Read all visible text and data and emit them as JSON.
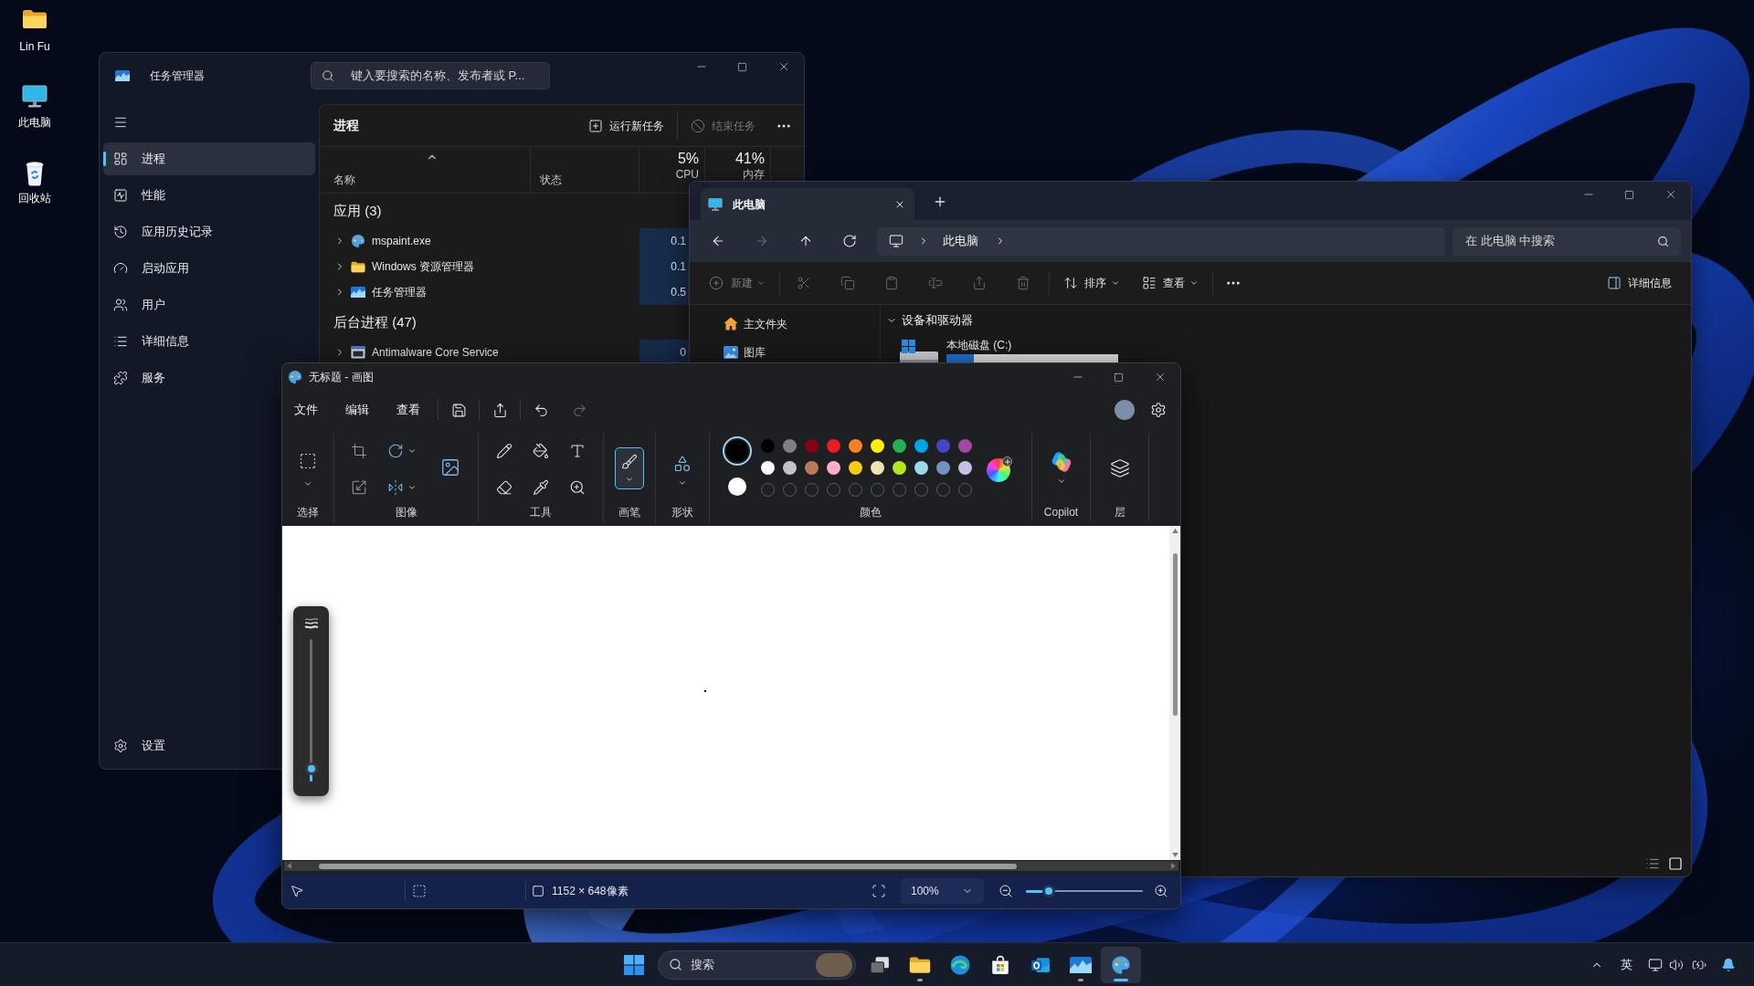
{
  "desktop_icons": [
    {
      "kind": "folder",
      "label": "Lin Fu"
    },
    {
      "kind": "computer",
      "label": "此电脑"
    },
    {
      "kind": "recycle-bin",
      "label": "回收站"
    }
  ],
  "task_manager": {
    "title": "任务管理器",
    "search": {
      "placeholder": "键入要搜索的名称、发布者或 P..."
    },
    "nav": [
      {
        "kind": "processes",
        "label": "进程",
        "selected": true
      },
      {
        "kind": "performance",
        "label": "性能",
        "selected": false
      },
      {
        "kind": "app-history",
        "label": "应用历史记录",
        "selected": false
      },
      {
        "kind": "startup",
        "label": "启动应用",
        "selected": false
      },
      {
        "kind": "users",
        "label": "用户",
        "selected": false
      },
      {
        "kind": "details",
        "label": "详细信息",
        "selected": false
      },
      {
        "kind": "services",
        "label": "服务",
        "selected": false
      }
    ],
    "settings": "设置",
    "page_title": "进程",
    "actions": [
      {
        "kind": "run",
        "label": "运行新任务",
        "disabled": false
      },
      {
        "kind": "end",
        "label": "结束任务",
        "disabled": true
      }
    ],
    "columns": [
      {
        "kind": "name",
        "label": "名称"
      },
      {
        "kind": "status",
        "label": "状态"
      },
      {
        "kind": "metric",
        "percent": "5%",
        "label": "CPU"
      },
      {
        "kind": "metric",
        "percent": "41%",
        "label": "内存"
      }
    ],
    "groups": [
      {
        "title": "应用 (3)",
        "rows": [
          {
            "kind": "paint",
            "name": "mspaint.exe",
            "cpu": "0.1"
          },
          {
            "kind": "explorer",
            "name": "Windows 资源管理器",
            "cpu": "0.1"
          },
          {
            "kind": "task-manager",
            "name": "任务管理器",
            "cpu": "0.5"
          }
        ]
      },
      {
        "title": "后台进程 (47)",
        "rows": [
          {
            "kind": "service",
            "name": "Antimalware Core Service",
            "cpu": "0"
          }
        ]
      }
    ]
  },
  "explorer": {
    "tabs": [
      {
        "label": "此电脑",
        "selected": true
      }
    ],
    "nav_buttons": [
      {
        "kind": "back",
        "disabled": false
      },
      {
        "kind": "forward",
        "disabled": true
      },
      {
        "kind": "up",
        "disabled": false
      },
      {
        "kind": "refresh",
        "disabled": false
      }
    ],
    "breadcrumb": [
      "此电脑"
    ],
    "search": {
      "placeholder": "在 此电脑 中搜索"
    },
    "new": {
      "label": "新建",
      "disabled": true
    },
    "edit_tools": [
      {
        "kind": "cut",
        "disabled": true
      },
      {
        "kind": "copy",
        "disabled": true
      },
      {
        "kind": "paste",
        "disabled": true
      },
      {
        "kind": "rename",
        "disabled": true
      },
      {
        "kind": "share",
        "disabled": true
      },
      {
        "kind": "delete",
        "disabled": true
      }
    ],
    "sort": "排序",
    "view": "查看",
    "details": "详细信息",
    "nav_pane": [
      {
        "kind": "home",
        "label": "主文件夹"
      },
      {
        "kind": "gallery",
        "label": "图库"
      }
    ],
    "section": {
      "title": "设备和驱动器",
      "expanded": true
    },
    "drives": [
      {
        "name": "本地磁盘 (C:)",
        "level": 0.16
      }
    ],
    "view_modes": [
      {
        "kind": "details",
        "selected": false
      },
      {
        "kind": "tiles",
        "selected": true
      }
    ]
  },
  "paint": {
    "title": "无标题 - 画图",
    "menus": [
      "文件",
      "编辑",
      "查看"
    ],
    "quick_actions": [
      {
        "kind": "save",
        "disabled": false
      },
      {
        "kind": "share",
        "disabled": false
      },
      {
        "kind": "undo",
        "disabled": false
      },
      {
        "kind": "redo",
        "disabled": true
      }
    ],
    "groups": [
      {
        "kind": "selection",
        "label": "选择"
      },
      {
        "kind": "image",
        "label": "图像"
      },
      {
        "kind": "tools",
        "label": "工具"
      },
      {
        "kind": "brushes",
        "label": "画笔"
      },
      {
        "kind": "shapes",
        "label": "形状"
      },
      {
        "kind": "colors",
        "label": "颜色"
      },
      {
        "kind": "copilot",
        "label": "Copilot"
      },
      {
        "kind": "layers",
        "label": "层"
      }
    ],
    "tools": [
      {
        "kind": "pencil",
        "selected": false
      },
      {
        "kind": "fill",
        "selected": false
      },
      {
        "kind": "text",
        "selected": false
      },
      {
        "kind": "eraser",
        "selected": false
      },
      {
        "kind": "picker",
        "selected": false
      },
      {
        "kind": "magnifier",
        "selected": false
      }
    ],
    "brush": {
      "selected": true
    },
    "current_colors": [
      {
        "kind": "primary",
        "color": "#000000",
        "selected": true
      },
      {
        "kind": "secondary",
        "color": "#ffffff",
        "selected": false
      }
    ],
    "palette": [
      {
        "color": "#000000"
      },
      {
        "color": "#7f7f7f"
      },
      {
        "color": "#880015"
      },
      {
        "color": "#ed1c24"
      },
      {
        "color": "#ff7f27"
      },
      {
        "color": "#fff200"
      },
      {
        "color": "#22b14c"
      },
      {
        "color": "#00a2e8"
      },
      {
        "color": "#3f48cc"
      },
      {
        "color": "#a349a4"
      },
      {
        "color": "#ffffff"
      },
      {
        "color": "#c3c3c3"
      },
      {
        "color": "#b97a57"
      },
      {
        "color": "#ffaec9"
      },
      {
        "color": "#ffc90e"
      },
      {
        "color": "#efe4b0"
      },
      {
        "color": "#b5e61d"
      },
      {
        "color": "#99d9ea"
      },
      {
        "color": "#7092be"
      },
      {
        "color": "#c8bfe7"
      }
    ],
    "brush_size": {
      "level": 0.05
    },
    "canvas_size": "1152 × 648像素",
    "zoom": {
      "value": "100%",
      "level": 0.16
    }
  },
  "taskbar": {
    "search": {
      "placeholder": "搜索"
    },
    "apps": [
      {
        "kind": "task-view",
        "running": false,
        "selected": false
      },
      {
        "kind": "explorer",
        "running": true,
        "selected": false
      },
      {
        "kind": "edge",
        "running": false,
        "selected": false
      },
      {
        "kind": "store",
        "running": false,
        "selected": false
      },
      {
        "kind": "outlook",
        "running": false,
        "selected": false
      },
      {
        "kind": "task-manager",
        "running": true,
        "selected": false
      },
      {
        "kind": "paint",
        "running": true,
        "selected": true
      }
    ],
    "ime": "英"
  }
}
